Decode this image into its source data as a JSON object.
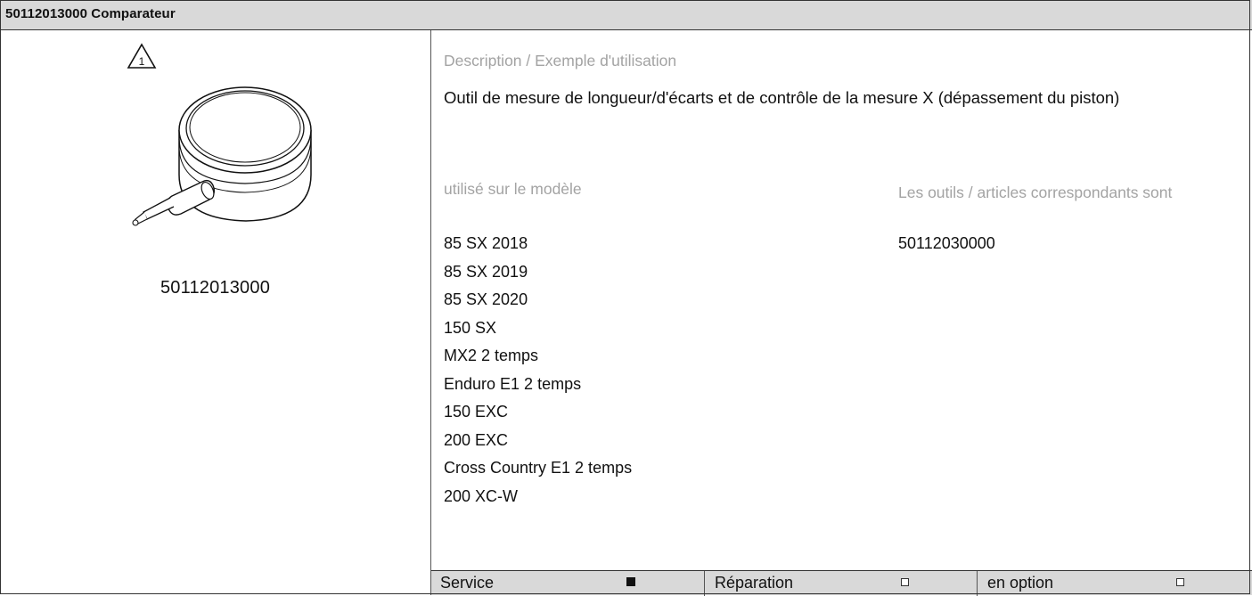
{
  "header": {
    "title": "50112013000 Comparateur"
  },
  "tool": {
    "image_part_number": "50112013000",
    "icons": {
      "warning": "warning-triangle-1-icon",
      "gauge": "dial-gauge-icon"
    }
  },
  "description": {
    "label": "Description / Exemple d'utilisation",
    "text": "Outil de mesure de longueur/d'écarts et de contrôle de la mesure X (dépassement du piston)"
  },
  "used_on": {
    "label": "utilisé sur le modèle",
    "models": [
      "85 SX 2018",
      "85 SX 2019",
      "85 SX 2020",
      "150 SX",
      "MX2 2 temps",
      "Enduro E1 2 temps",
      "150 EXC",
      "200 EXC",
      "Cross Country E1 2 temps",
      "200 XC-W"
    ]
  },
  "related": {
    "label": "Les outils / articles correspondants sont",
    "items": [
      "50112030000"
    ]
  },
  "footer": {
    "service_label": "Service",
    "service_checked": true,
    "repair_label": "Réparation",
    "repair_checked": false,
    "optional_label": "en option",
    "optional_checked": false
  },
  "colors": {
    "header_bg": "#d9d9d9",
    "label_gray": "#a3a3a3",
    "border": "#333333"
  }
}
